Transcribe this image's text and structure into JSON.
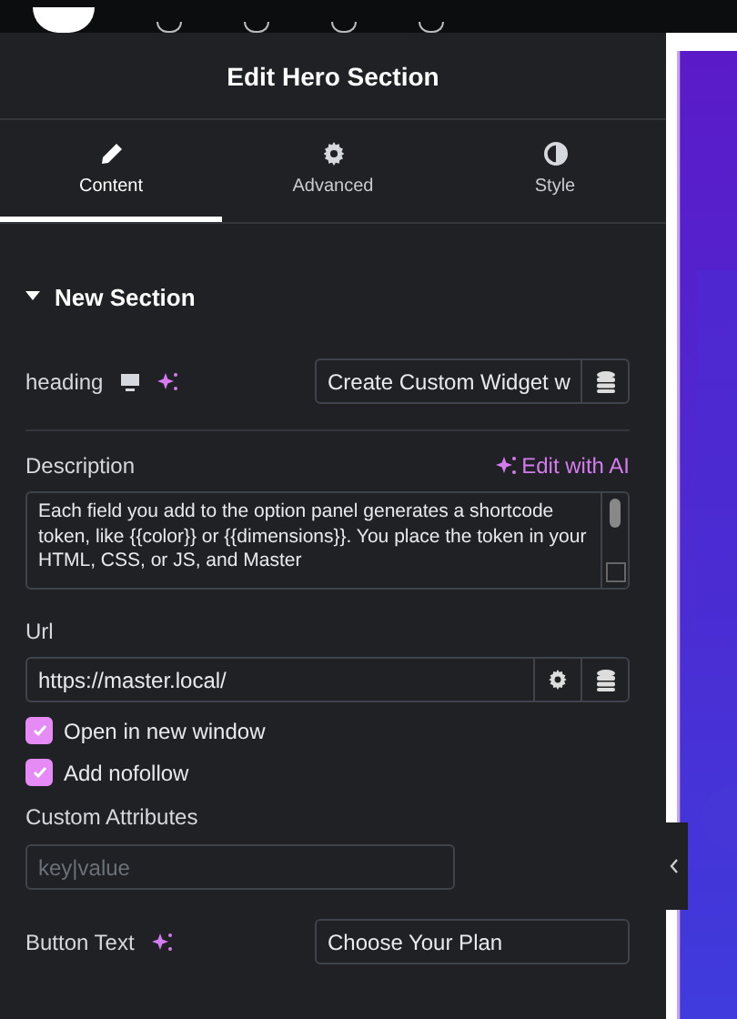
{
  "window": {
    "title": "Edit Hero Section"
  },
  "tabs": [
    {
      "label": "Content",
      "kind": "pencil",
      "selected": true
    },
    {
      "label": "Advanced",
      "kind": "gear",
      "selected": false
    },
    {
      "label": "Style",
      "kind": "contrast",
      "selected": false
    }
  ],
  "section": {
    "title": "New Section",
    "expanded": true
  },
  "heading": {
    "label": "heading",
    "value": "Create Custom Widget w"
  },
  "description": {
    "label": "Description",
    "ai_link": "Edit with AI",
    "value": "Each field you add to the option panel generates a shortcode token, like {{color}} or {{dimensions}}. You place the token in your HTML, CSS, or JS, and Master"
  },
  "url": {
    "label": "Url",
    "value": "https://master.local/"
  },
  "options": [
    {
      "label": "Open in new window",
      "checked": true
    },
    {
      "label": "Add nofollow",
      "checked": true
    }
  ],
  "custom_attributes": {
    "label": "Custom Attributes",
    "placeholder": "key|value"
  },
  "button_text": {
    "label": "Button Text",
    "value": "Choose Your Plan"
  }
}
